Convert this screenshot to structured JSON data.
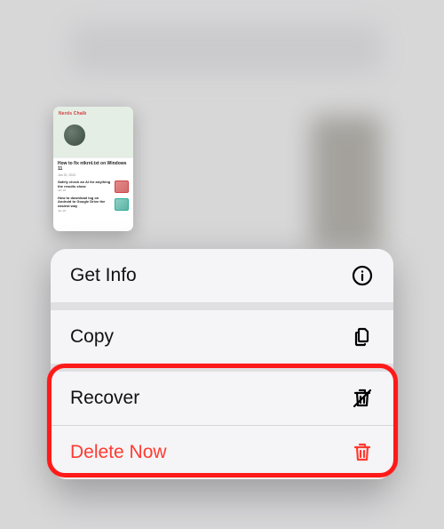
{
  "preview": {
    "brand": "Nerds Chalk",
    "headline": "How to fix ntkrnl.txt on Windows 11",
    "headline_date": "Jan 20, 2022",
    "row1_title": "Safely check an AI for anything the results show",
    "row1_date": "Jan 18",
    "row2_title": "How to download log on Android to Google Drive the easiest way",
    "row2_date": "Jan 18"
  },
  "menu": {
    "get_info": "Get Info",
    "copy": "Copy",
    "recover": "Recover",
    "delete_now": "Delete Now"
  },
  "colors": {
    "destructive": "#ff3b30",
    "highlight": "#ff1a1a"
  }
}
